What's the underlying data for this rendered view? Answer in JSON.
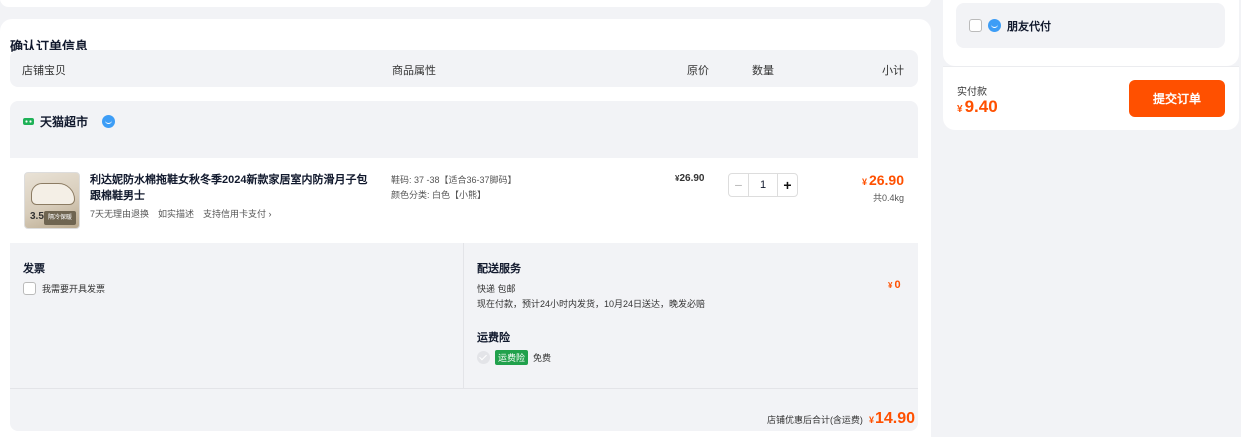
{
  "colors": {
    "accent": "#ff5000",
    "ww_blue": "#3d9df6",
    "ins_green": "#21a14c",
    "tmall_green": "#1fb157"
  },
  "order_section": {
    "title": "确认订单信息",
    "columns": {
      "store_item": "店铺宝贝",
      "attributes": "商品属性",
      "original_price": "原价",
      "quantity": "数量",
      "subtotal": "小计"
    }
  },
  "shop": {
    "name": "天猫超市",
    "logo_icon": "tmall-supermarket-icon",
    "chat_icon": "wangwang-icon"
  },
  "item": {
    "thumb_number": "3.5",
    "thumb_tag": "隔冷保暖",
    "title": "利达妮防水棉拖鞋女秋冬季2024新款家居室内防滑月子包跟棉鞋男士",
    "tags": [
      "7天无理由退换",
      "如实描述",
      "支持信用卡支付 ›"
    ],
    "attr_size": "鞋码: 37 -38【适合36-37脚码】",
    "attr_color": "颜色分类: 白色【小熊】",
    "unit_price": "26.90",
    "currency": "¥",
    "quantity": "1",
    "minus": "−",
    "plus": "+",
    "subtotal": "26.90",
    "weight": "共0.4kg"
  },
  "invoice": {
    "title": "发票",
    "option": "我需要开具发票"
  },
  "delivery": {
    "title": "配送服务",
    "method": "快递 包邮",
    "eta": "现在付款，预计24小时内发货，10月24日送达，晚发必赔",
    "price": "0"
  },
  "insurance": {
    "title": "运费险",
    "badge": "运费险",
    "note": "免费"
  },
  "shop_total": {
    "label": "店铺优惠后合计(含运费)",
    "amount": "14.90"
  },
  "sidebar": {
    "friend_pay": "朋友代付",
    "pay_label": "实付款",
    "pay_amount": "9.40",
    "submit": "提交订单"
  }
}
